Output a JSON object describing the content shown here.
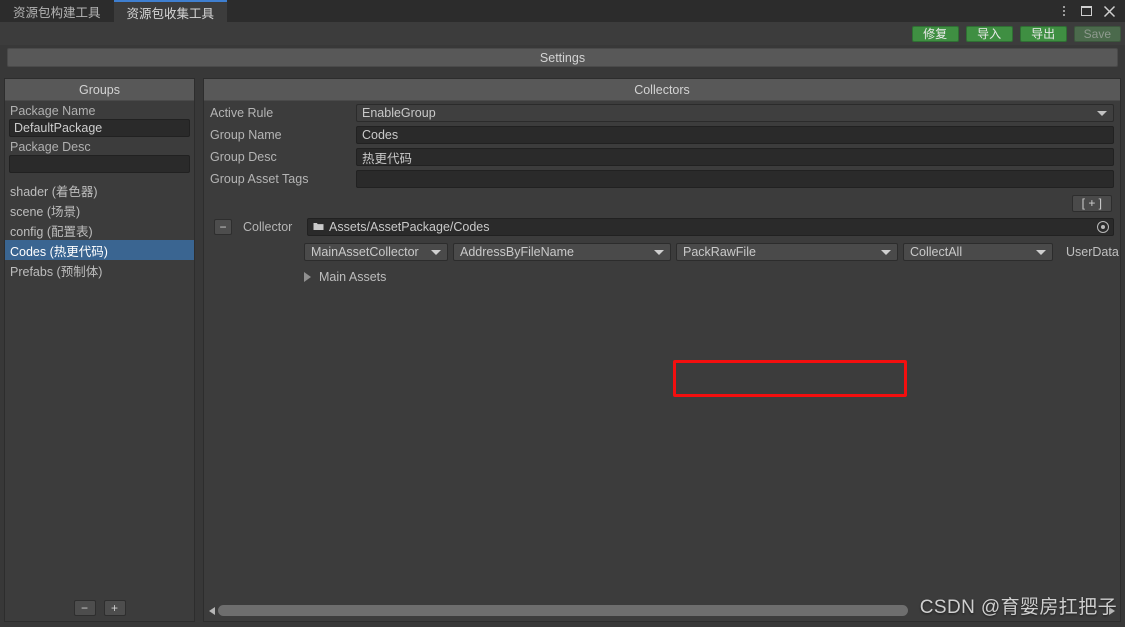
{
  "window": {
    "tabs": [
      {
        "label": "资源包构建工具",
        "active": false
      },
      {
        "label": "资源包收集工具",
        "active": true
      }
    ],
    "controls": {
      "menu_icon": "vertical-dots-icon",
      "maximize_icon": "maximize-icon",
      "close_icon": "close-icon"
    }
  },
  "toolbar": {
    "repair_label": "修复",
    "import_label": "导入",
    "export_label": "导出",
    "save_label": "Save",
    "accent_green": "#3f8f42"
  },
  "settings_bar": {
    "label": "Settings"
  },
  "groups_panel": {
    "header": "Groups",
    "package_name_label": "Package Name",
    "package_name_value": "DefaultPackage",
    "package_desc_label": "Package Desc",
    "package_desc_value": "",
    "items": [
      {
        "label": "shader (着色器)",
        "selected": false
      },
      {
        "label": "scene (场景)",
        "selected": false
      },
      {
        "label": "config (配置表)",
        "selected": false
      },
      {
        "label": "Codes (热更代码)",
        "selected": true
      },
      {
        "label": "Prefabs (预制体)",
        "selected": false
      }
    ],
    "selected_color": "#3a6591",
    "remove_button": "−",
    "add_button": "+"
  },
  "collectors_panel": {
    "header": "Collectors",
    "fields": [
      {
        "label": "Active Rule",
        "value": "EnableGroup",
        "type": "popup"
      },
      {
        "label": "Group Name",
        "value": "Codes",
        "type": "text"
      },
      {
        "label": "Group Desc",
        "value": "热更代码",
        "type": "text"
      },
      {
        "label": "Group Asset Tags",
        "value": "",
        "type": "text"
      }
    ],
    "add_collector_button": "[ + ]",
    "collector": {
      "remove_button": "−",
      "label": "Collector",
      "folder_icon": "folder-icon",
      "path": "Assets/AssetPackage/Codes",
      "picker_icon": "target-picker-icon",
      "collector_type": "MainAssetCollector",
      "address_rule": "AddressByFileName",
      "pack_rule": "PackRawFile",
      "filter_rule": "CollectAll",
      "user_data_label": "UserData",
      "foldout_label": "Main Assets",
      "foldout_icon": "chevron-right-icon"
    },
    "highlight_color": "#f40f0f",
    "scrollbar": {
      "left_arrow_icon": "arrow-left-icon",
      "right_arrow_icon": "arrow-right-icon"
    }
  },
  "watermark": {
    "text": "CSDN @育婴房扛把子"
  }
}
